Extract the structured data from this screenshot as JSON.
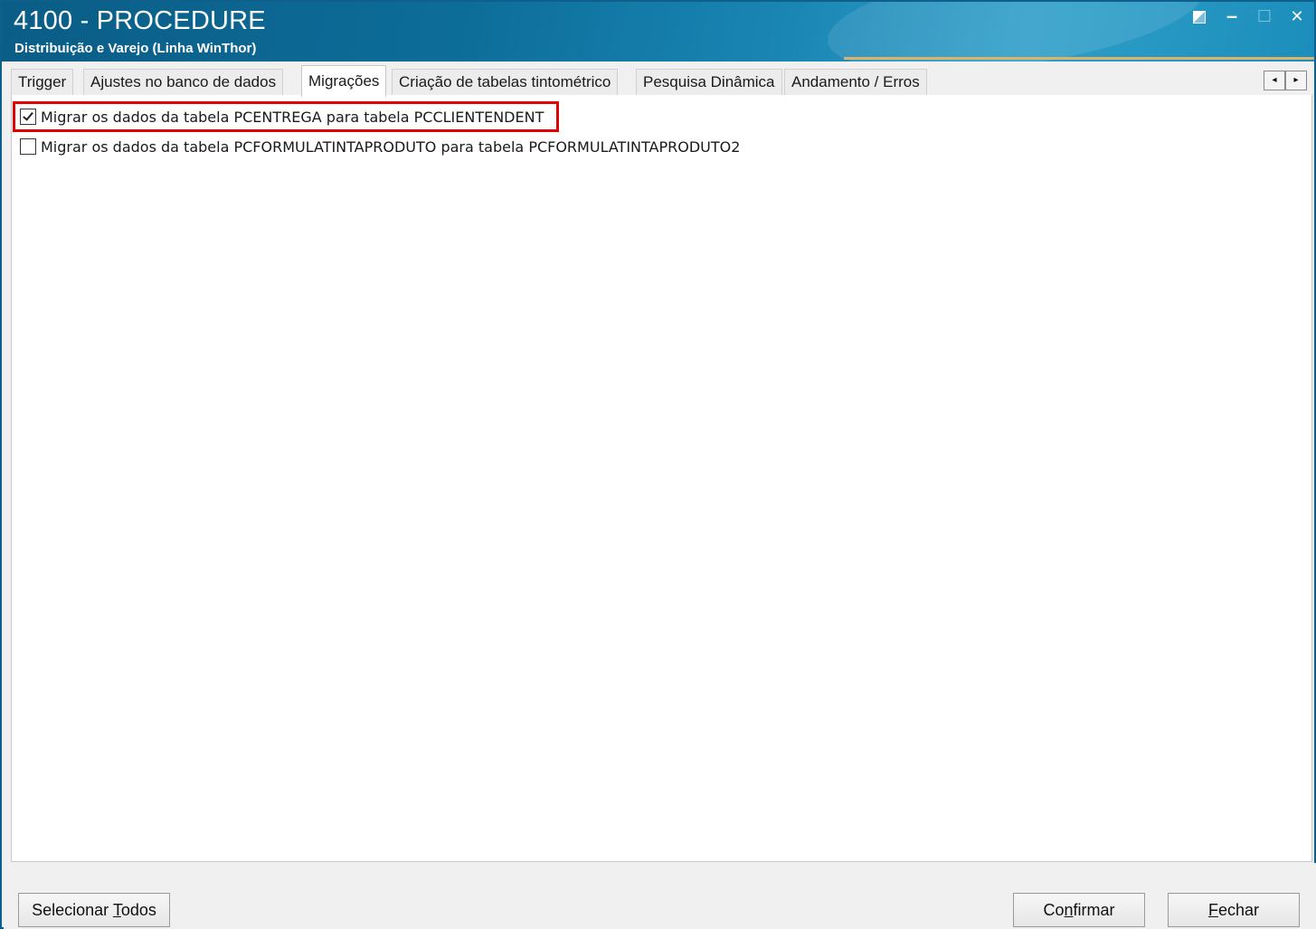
{
  "window": {
    "title": "4100 - PROCEDURE",
    "subtitle": "Distribuição e Varejo (Linha WinThor)",
    "controls": {
      "pin_icon": "pin-icon",
      "minimize": "‒",
      "maximize": "☐",
      "close": "✕"
    }
  },
  "tabs": [
    {
      "label": "Trigger"
    },
    {
      "label": "Ajustes no banco de dados"
    },
    {
      "label": "Migrações",
      "active": true
    },
    {
      "label": "Criação de tabelas tintométrico"
    },
    {
      "label": "Pesquisa Dinâmica"
    },
    {
      "label": "Andamento / Erros"
    }
  ],
  "tab_scroll": {
    "left": "◂",
    "right": "▸"
  },
  "options": [
    {
      "label": "Migrar os dados da tabela PCENTREGA para tabela PCCLIENTENDENT",
      "checked": true
    },
    {
      "label": "Migrar os dados da tabela PCFORMULATINTAPRODUTO para tabela PCFORMULATINTAPRODUTO2",
      "checked": false
    }
  ],
  "buttons": {
    "select_all": {
      "pre": "Selecionar ",
      "accel": "T",
      "post": "odos"
    },
    "confirm": {
      "pre": "Co",
      "accel": "n",
      "post": "firmar"
    },
    "close": {
      "pre": "",
      "accel": "F",
      "post": "echar"
    }
  },
  "colors": {
    "highlight": "#e00000",
    "titlebar": "#0d6d99"
  }
}
